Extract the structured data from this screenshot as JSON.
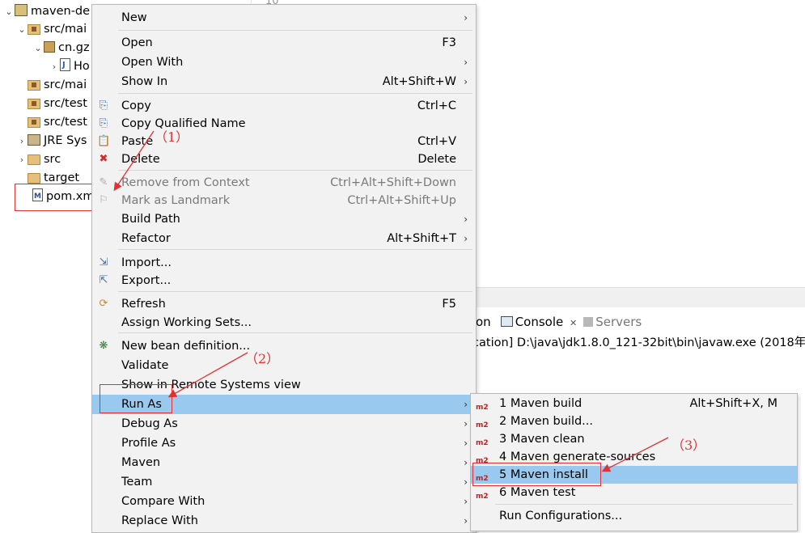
{
  "editor": {
    "line_number": "10"
  },
  "tree": [
    {
      "label": "maven-de",
      "icon": "project-icon",
      "arrow": "⌄"
    },
    {
      "label": "src/mai",
      "icon": "source-folder-icon",
      "arrow": "⌄"
    },
    {
      "label": "cn.gz",
      "icon": "package-icon",
      "arrow": "⌄"
    },
    {
      "label": "Ho",
      "icon": "java-file-icon",
      "arrow": "›"
    },
    {
      "label": "src/mai",
      "icon": "source-folder-icon",
      "arrow": ""
    },
    {
      "label": "src/test",
      "icon": "source-folder-icon",
      "arrow": ""
    },
    {
      "label": "src/test",
      "icon": "source-folder-icon",
      "arrow": ""
    },
    {
      "label": "JRE Sys",
      "icon": "library-icon",
      "arrow": "›"
    },
    {
      "label": "src",
      "icon": "folder-icon",
      "arrow": "›"
    },
    {
      "label": "target",
      "icon": "folder-icon",
      "arrow": ""
    },
    {
      "label": "pom.xm",
      "icon": "xml-file-icon",
      "arrow": ""
    }
  ],
  "menu": {
    "items": [
      {
        "label": "New",
        "shortcut": "",
        "sub": true
      },
      {
        "label": "Open",
        "shortcut": "F3",
        "sub": false
      },
      {
        "label": "Open With",
        "shortcut": "",
        "sub": true
      },
      {
        "label": "Show In",
        "shortcut": "Alt+Shift+W",
        "sub": true
      },
      {
        "label": "Copy",
        "shortcut": "Ctrl+C",
        "sub": false
      },
      {
        "label": "Copy Qualified Name",
        "shortcut": "",
        "sub": false
      },
      {
        "label": "Paste",
        "shortcut": "Ctrl+V",
        "sub": false
      },
      {
        "label": "Delete",
        "shortcut": "Delete",
        "sub": false
      },
      {
        "label": "Remove from Context",
        "shortcut": "Ctrl+Alt+Shift+Down",
        "sub": false
      },
      {
        "label": "Mark as Landmark",
        "shortcut": "Ctrl+Alt+Shift+Up",
        "sub": false
      },
      {
        "label": "Build Path",
        "shortcut": "",
        "sub": true
      },
      {
        "label": "Refactor",
        "shortcut": "Alt+Shift+T",
        "sub": true
      },
      {
        "label": "Import...",
        "shortcut": "",
        "sub": false
      },
      {
        "label": "Export...",
        "shortcut": "",
        "sub": false
      },
      {
        "label": "Refresh",
        "shortcut": "F5",
        "sub": false
      },
      {
        "label": "Assign Working Sets...",
        "shortcut": "",
        "sub": false
      },
      {
        "label": "New bean definition...",
        "shortcut": "",
        "sub": false
      },
      {
        "label": "Validate",
        "shortcut": "",
        "sub": false
      },
      {
        "label": "Show in Remote Systems view",
        "shortcut": "",
        "sub": false
      },
      {
        "label": "Run As",
        "shortcut": "",
        "sub": true
      },
      {
        "label": "Debug As",
        "shortcut": "",
        "sub": true
      },
      {
        "label": "Profile As",
        "shortcut": "",
        "sub": true
      },
      {
        "label": "Maven",
        "shortcut": "",
        "sub": true
      },
      {
        "label": "Team",
        "shortcut": "",
        "sub": true
      },
      {
        "label": "Compare With",
        "shortcut": "",
        "sub": true
      },
      {
        "label": "Replace With",
        "shortcut": "",
        "sub": true
      }
    ],
    "submenu_arrow": "›"
  },
  "run_as_submenu": {
    "icon_text": "m2",
    "items": [
      {
        "label": "1 Maven build",
        "shortcut": "Alt+Shift+X, M"
      },
      {
        "label": "2 Maven build...",
        "shortcut": ""
      },
      {
        "label": "3 Maven clean",
        "shortcut": ""
      },
      {
        "label": "4 Maven generate-sources",
        "shortcut": ""
      },
      {
        "label": "5 Maven install",
        "shortcut": ""
      },
      {
        "label": "6 Maven test",
        "shortcut": ""
      }
    ],
    "run_configurations": "Run Configurations..."
  },
  "console": {
    "prev_tab_fragment": "on",
    "tab_label": "Console",
    "tab_close": "✕",
    "servers_label": "Servers",
    "line": "ication] D:\\java\\jdk1.8.0_121-32bit\\bin\\javaw.exe (2018年"
  },
  "annotations": [
    "（1）",
    "（2）",
    "（3）"
  ],
  "colors": {
    "selection": "#99c9ef",
    "annotation": "#e33131",
    "menu_bg": "#f2f2f2",
    "m2_icon": "#c41f1f"
  }
}
